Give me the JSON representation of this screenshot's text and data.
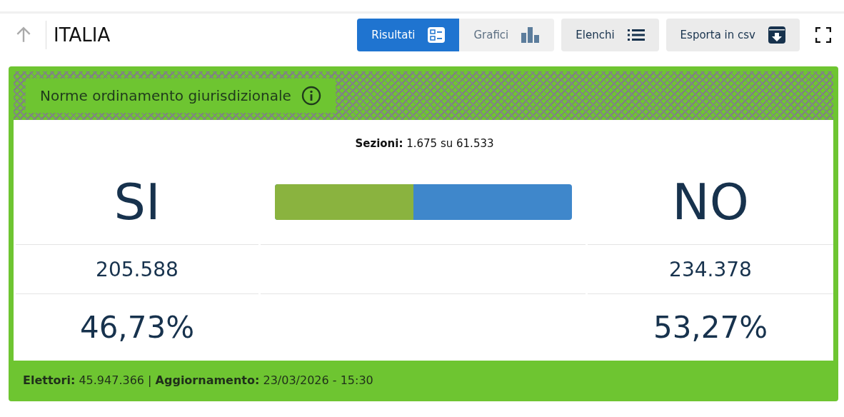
{
  "header": {
    "title": "ITALIA"
  },
  "view_tabs": [
    {
      "label": "Risultati",
      "selected": true,
      "kind": "results"
    },
    {
      "label": "Grafici",
      "selected": false,
      "kind": "chart"
    }
  ],
  "buttons": [
    {
      "label": "Elenchi",
      "kind": "list"
    },
    {
      "label": "Esporta in csv",
      "kind": "download"
    }
  ],
  "card": {
    "title": "Norme ordinamento giurisdizionale",
    "sections": "**Sezioni:** 1.675 su 61.533",
    "options": [
      {
        "label": "SI",
        "votes": "205.588",
        "percent": "46,73%",
        "color": "#8ab33f"
      },
      {
        "label": "NO",
        "votes": "234.378",
        "percent": "53,27%",
        "color": "#3f87cb"
      }
    ],
    "bar": {
      "level": 0.4673
    },
    "footer": "**Elettori:** 45.947.366 | **Aggiornamento:** 23/03/2026 - 15:30"
  }
}
